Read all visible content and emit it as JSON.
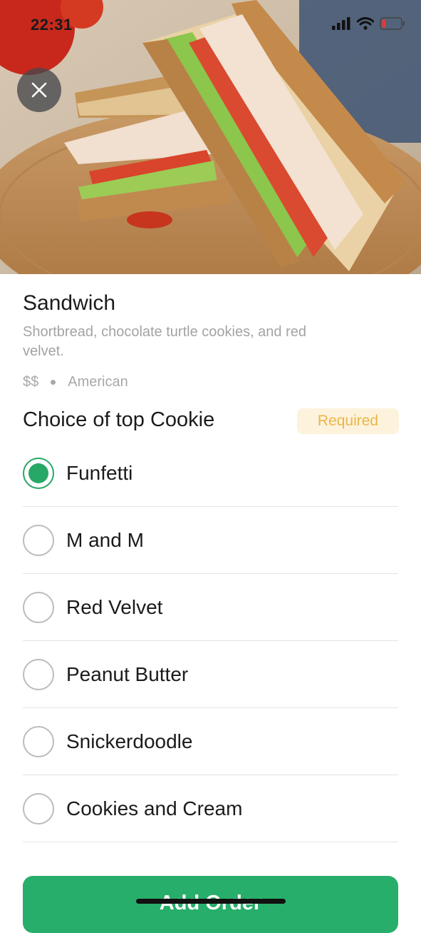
{
  "status_bar": {
    "time": "22:31"
  },
  "hero": {
    "image_icon": "sandwich-photo"
  },
  "product": {
    "title": "Sandwich",
    "description": "Shortbread, chocolate turtle cookies, and red velvet.",
    "price_tier": "$$",
    "cuisine": "American"
  },
  "choice": {
    "title": "Choice of top Cookie",
    "badge": "Required",
    "options": [
      {
        "label": "Funfetti",
        "selected": true
      },
      {
        "label": "M and M",
        "selected": false
      },
      {
        "label": "Red Velvet",
        "selected": false
      },
      {
        "label": "Peanut Butter",
        "selected": false
      },
      {
        "label": "Snickerdoodle",
        "selected": false
      },
      {
        "label": "Cookies and Cream",
        "selected": false
      }
    ]
  },
  "footer": {
    "add_label": "Add Order"
  },
  "colors": {
    "accent": "#27ae6a",
    "badge_bg": "#fdf3dc",
    "badge_text": "#e9b649"
  }
}
